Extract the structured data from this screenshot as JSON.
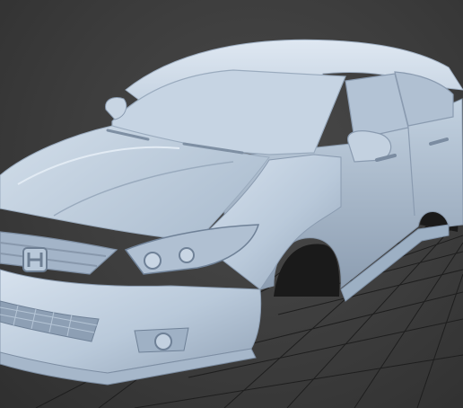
{
  "viewport": {
    "content": "car-body-3d-render",
    "background_color": "#3c3c3c",
    "grid_color": "#1e1e1e",
    "model_color": "#b9c9da",
    "shadow_color": "#7f8fa2",
    "highlight_color": "#dde7f2"
  },
  "model": {
    "badge_icon": "honda-h-logo"
  }
}
